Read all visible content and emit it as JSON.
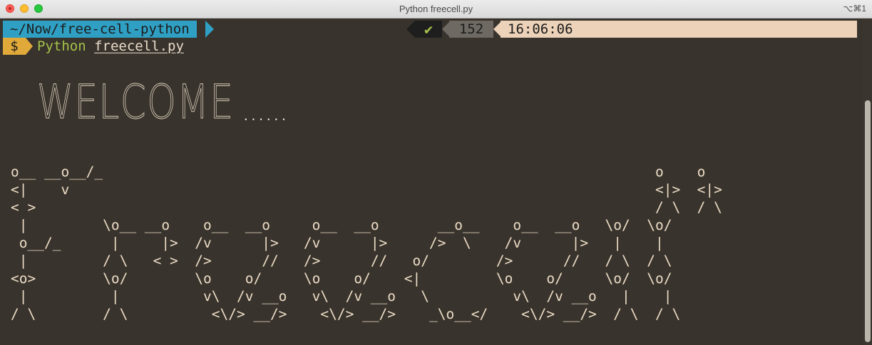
{
  "window": {
    "title": "Python freecell.py",
    "shortcut": "⌥⌘1"
  },
  "prompt": {
    "path": "~/Now/free-cell-python",
    "status_icon": "✔",
    "history_number": "152",
    "time": "16:06:06",
    "symbol": "$",
    "command": "Python",
    "argument": "freecell.py"
  },
  "output": {
    "welcome": "WELCOME",
    "dots": "......",
    "ascii_art": "o__ __o__/_                                                                  o    o\n<|    v                                                                      <|>  <|>\n< >                                                                          / \\  / \\\n |         \\o__ __o    o__  __o     o__  __o       __o__    o__  __o   \\o/  \\o/\n o__/_      |     |>  /v      |>   /v      |>     />  \\    /v      |>   |    |\n |         / \\   < >  />      //   />      //   o/        />      //   / \\  / \\\n<o>        \\o/        \\o    o/     \\o    o/    <|         \\o    o/     \\o/  \\o/\n |          |          v\\  /v __o   v\\  /v __o   \\          v\\  /v __o   |    |\n/ \\        / \\          <\\/> __/>    <\\/> __/>    _\\o__</    <\\/> __/>  / \\  / \\"
  },
  "colors": {
    "background": "#38332c",
    "path_segment": "#2fa0c4",
    "prompt_symbol": "#e0a93a",
    "command": "#a6c24a",
    "time_segment": "#ecd2b8",
    "text": "#ecdcc6"
  }
}
